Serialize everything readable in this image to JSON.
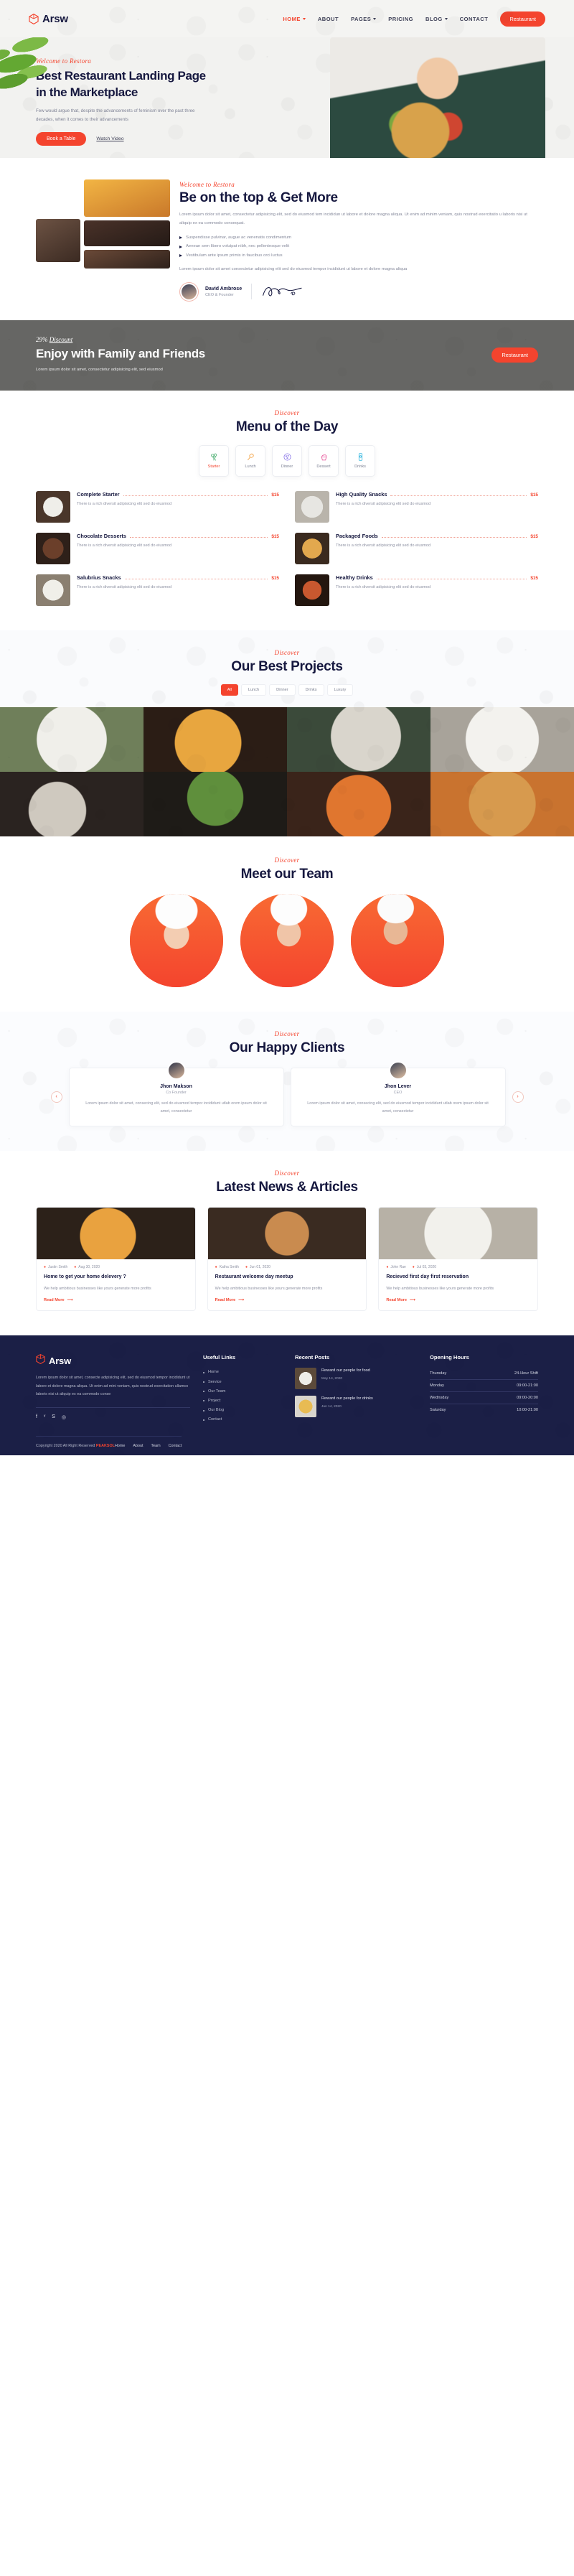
{
  "header": {
    "logo": "Arsw",
    "logo_icon": "cube-icon",
    "nav": [
      {
        "label": "HOME",
        "active": true,
        "caret": true
      },
      {
        "label": "ABOUT",
        "active": false,
        "caret": false
      },
      {
        "label": "PAGES",
        "active": false,
        "caret": true
      },
      {
        "label": "PRICING",
        "active": false,
        "caret": false
      },
      {
        "label": "BLOG",
        "active": false,
        "caret": true
      },
      {
        "label": "CONTACT",
        "active": false,
        "caret": false
      }
    ],
    "cta": "Restaurant"
  },
  "hero": {
    "eyebrow": "Welcome to Restora",
    "title_line1": "Best Restaurant Landing Page",
    "title_line2": "in the Marketplace",
    "paragraph": "Few would argue that, despite the advancements of feminism over the past three decades, when it comes to their advancements",
    "primary_btn": "Book a Table",
    "secondary_link": "Watch Video"
  },
  "about": {
    "eyebrow": "Welcome to Restora",
    "title": "Be on the top & Get More",
    "paragraph1": "Lorem ipsum dolor sit amet, consectetur adipisicing elit, sed do eiusmod tem incididun ut labore et dolore magna aliqua. Ut enim ad minim veniam, quis nostrud exercitatio u laboris nisi ut aliquip ex ea commodo consequat.",
    "bullets": [
      "Suspendisse pulvinar, augue ac venenatis condimentum",
      "Aenean sem libero volutpat nibh, nec pellentesque velit",
      "Vestibulum ante ipsum primis in faucibus orci luctus"
    ],
    "paragraph2": "Lorem ipsum dolor sit amet consectetur adipisicing elit sed do eiusmod tempor incididunt ut labore et dolore magna aliqua",
    "author_name": "David Ambrose",
    "author_role": "CEO & Founder",
    "signature_icon": "signature-icon"
  },
  "promo": {
    "discount_pct": "29%",
    "discount_word": "Discount",
    "title": "Enjoy with Family and Friends",
    "paragraph": "Lorem ipsum dolor sit amet, consectetur adipisicing elit, sed eiusmod",
    "cta": "Restaurant"
  },
  "menu": {
    "eyebrow": "Discover",
    "title": "Menu of the Day",
    "tabs": [
      {
        "label": "Starter",
        "icon": "broccoli-icon",
        "color": "#4caf72",
        "active": true
      },
      {
        "label": "Lunch",
        "icon": "chicken-icon",
        "color": "#f29a33",
        "active": false
      },
      {
        "label": "Dinner",
        "icon": "pizza-icon",
        "color": "#8d7ae8",
        "active": false
      },
      {
        "label": "Dessert",
        "icon": "cupcake-icon",
        "color": "#e8559a",
        "active": false
      },
      {
        "label": "Drinks",
        "icon": "can-icon",
        "color": "#3bb9e0",
        "active": false
      }
    ],
    "items": [
      {
        "name": "Complete Starter",
        "desc": "There is a rich diversit adipisicing elit sed do eiusmod",
        "price": "$15"
      },
      {
        "name": "High Quality Snacks",
        "desc": "There is a rich diversit adipisicing elit sed do eiusmod",
        "price": "$15"
      },
      {
        "name": "Chocolate Desserts",
        "desc": "There is a rich diversit adipisicing elit sed do eiusmod",
        "price": "$15"
      },
      {
        "name": "Packaged Foods",
        "desc": "There is a rich diversit adipisicing elit sed do eiusmod",
        "price": "$15"
      },
      {
        "name": "Salubrius Snacks",
        "desc": "There is a rich diversit adipisicing elit sed do eiusmod",
        "price": "$15"
      },
      {
        "name": "Healthy Drinks",
        "desc": "There is a rich diversit adipisicing elit sed do eiusmod",
        "price": "$15"
      }
    ]
  },
  "projects": {
    "eyebrow": "Discover",
    "title": "Our Best Projects",
    "filters": [
      {
        "label": "All",
        "active": true
      },
      {
        "label": "Lunch",
        "active": false
      },
      {
        "label": "Dinner",
        "active": false
      },
      {
        "label": "Drinks",
        "active": false
      },
      {
        "label": "Luxury",
        "active": false
      }
    ]
  },
  "team": {
    "eyebrow": "Discover",
    "title": "Meet our Team"
  },
  "clients": {
    "eyebrow": "Discover",
    "title": "Our Happy Clients",
    "prev_icon": "chevron-left-icon",
    "next_icon": "chevron-right-icon",
    "cards": [
      {
        "name": "Jhon Makson",
        "role": "Co Founder",
        "quote": "Lorem ipsum dolor sit amet, consecing elit, sed do eiusmod tempor incididunt utlab orem ipsum dolor sit amet, consectetur"
      },
      {
        "name": "Jhon Lever",
        "role": "CEO",
        "quote": "Lorem ipsum dolor sit amet, consecing elit, sed do eiusmod tempor incididunt utlab orem ipsum dolor sit amet, consectetur"
      }
    ]
  },
  "blog": {
    "eyebrow": "Discover",
    "title": "Latest News & Articles",
    "posts": [
      {
        "author": "Justin Smith",
        "date": "Aug 30, 2020",
        "title": "Home to get your home delevery ?",
        "excerpt": "We help ambitious businesses like yours generate more profits",
        "cta": "Read More"
      },
      {
        "author": "Katha Smith",
        "date": "Jun 01, 2020",
        "title": "Restaurant welcome day meetup",
        "excerpt": "We help ambitious businesses like yours generate more profits",
        "cta": "Read More"
      },
      {
        "author": "John Rae",
        "date": "Jul 03, 2020",
        "title": "Recieved first day first reservation",
        "excerpt": "We help ambitious businesses like yours generate more profits",
        "cta": "Read More"
      }
    ]
  },
  "footer": {
    "logo": "Arsw",
    "about": "Lorem ipsum dolor sit amet, consecte adipisicing elit, sed do eiusmod tempor incididunt ut labore et dolore magna aliqua. Ut enim ad mini veniam, quis nostrud exercitation ullamco laboris nisi ut aliquip ex ea commodo conse",
    "social": [
      {
        "icon": "facebook-icon",
        "glyph": "f"
      },
      {
        "icon": "twitter-icon",
        "glyph": "ᵛ"
      },
      {
        "icon": "skype-icon",
        "glyph": "S"
      },
      {
        "icon": "instagram-icon",
        "glyph": "◎"
      }
    ],
    "links_title": "Useful Links",
    "links": [
      "Home",
      "Service",
      "Our Team",
      "Project",
      "Our Blog",
      "Contact"
    ],
    "posts_title": "Recent Posts",
    "posts": [
      {
        "title": "Reward our people for food",
        "date": "May 14, 2020"
      },
      {
        "title": "Reward our people for drinks",
        "date": "Jun 14, 2020"
      }
    ],
    "hours_title": "Opening Hours",
    "hours": [
      {
        "day": "Thursday",
        "time": "24-Hour Shift"
      },
      {
        "day": "Monday",
        "time": "09:00-21:00"
      },
      {
        "day": "Wednsday",
        "time": "09:00-20:00"
      },
      {
        "day": "Saturday",
        "time": "10:00-21:00"
      }
    ],
    "copyright": "Copyright 2020 All Right Reserved",
    "copyright_brand": "PEAKSOL",
    "bottom_nav": [
      "Home",
      "About",
      "Team",
      "Contact"
    ]
  },
  "colors": {
    "accent": "#f4442e",
    "dark": "#16183f",
    "footer_bg": "#1b1f46"
  }
}
